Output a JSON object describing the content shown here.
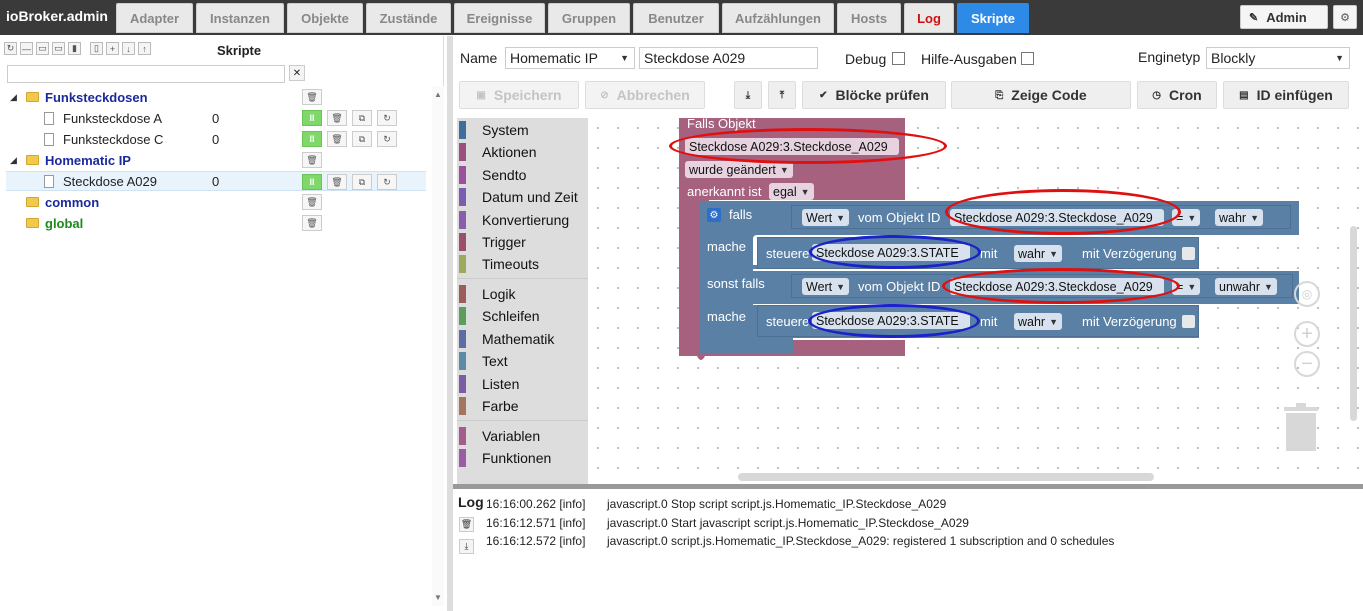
{
  "app": {
    "title": "ioBroker.admin"
  },
  "tabs": [
    {
      "label": "Adapter"
    },
    {
      "label": "Instanzen"
    },
    {
      "label": "Objekte"
    },
    {
      "label": "Zustände"
    },
    {
      "label": "Ereignisse"
    },
    {
      "label": "Gruppen"
    },
    {
      "label": "Benutzer"
    },
    {
      "label": "Aufzählungen"
    },
    {
      "label": "Hosts"
    },
    {
      "label": "Log"
    },
    {
      "label": "Skripte"
    }
  ],
  "user": {
    "name": "Admin"
  },
  "scripts_panel": {
    "title": "Skripte",
    "filter_value": "",
    "tree": [
      {
        "name": "Funksteckdosen",
        "type": "folder",
        "value": ""
      },
      {
        "name": "Funksteckdose A",
        "type": "script",
        "value": "0"
      },
      {
        "name": "Funksteckdose C",
        "type": "script",
        "value": "0"
      },
      {
        "name": "Homematic IP",
        "type": "folder",
        "value": ""
      },
      {
        "name": "Steckdose A029",
        "type": "script",
        "value": "0"
      },
      {
        "name": "common",
        "type": "folder",
        "value": ""
      },
      {
        "name": "global",
        "type": "folder",
        "value": ""
      }
    ]
  },
  "editor": {
    "name_label": "Name",
    "folder_select": "Homematic IP",
    "script_name": "Steckdose A029",
    "debug_label": "Debug",
    "hint_label": "Hilfe-Ausgaben",
    "engine_label": "Enginetyp",
    "engine_value": "Blockly",
    "buttons": {
      "save": "Speichern",
      "cancel": "Abbrechen",
      "check": "Blöcke prüfen",
      "show_code": "Zeige Code",
      "cron": "Cron",
      "insert_id": "ID einfügen"
    }
  },
  "toolbox": {
    "categories": [
      {
        "label": "System",
        "color": "#3e6f9c"
      },
      {
        "label": "Aktionen",
        "color": "#9c4f7c"
      },
      {
        "label": "Sendto",
        "color": "#9c4f9c"
      },
      {
        "label": "Datum und Zeit",
        "color": "#7c5cb0"
      },
      {
        "label": "Konvertierung",
        "color": "#8a5cb0"
      },
      {
        "label": "Trigger",
        "color": "#9c4f6c"
      },
      {
        "label": "Timeouts",
        "color": "#9caa5c"
      },
      {
        "label": "Logik",
        "color": "#9c5c5c"
      },
      {
        "label": "Schleifen",
        "color": "#5c9c5c"
      },
      {
        "label": "Mathematik",
        "color": "#5c6ca5"
      },
      {
        "label": "Text",
        "color": "#5c8ca5"
      },
      {
        "label": "Listen",
        "color": "#7c5ca5"
      },
      {
        "label": "Farbe",
        "color": "#a5745c"
      },
      {
        "label": "Variablen",
        "color": "#a55c8c"
      },
      {
        "label": "Funktionen",
        "color": "#9c5ca5"
      }
    ]
  },
  "blocks": {
    "trigger_title": "Falls Objekt",
    "trigger_object": "Steckdose A029:3.Steckdose_A029",
    "trigger_condition": "wurde geändert",
    "acknowledged_label": "anerkannt ist",
    "acknowledged_value": "egal",
    "if_label": "falls",
    "do_label": "mache",
    "elseif_label": "sonst falls",
    "value_label": "Wert",
    "from_object_label": "vom Objekt ID",
    "cond1_object": "Steckdose A029:3.Steckdose_A029",
    "cond1_op": "=",
    "cond1_value": "wahr",
    "action_label": "steuere",
    "action1_object": "Steckdose A029:3.STATE",
    "with_label": "mit",
    "action1_value": "wahr",
    "delay_label": "mit Verzögerung",
    "cond2_object": "Steckdose A029:3.Steckdose_A029",
    "cond2_op": "=",
    "cond2_value": "unwahr",
    "action2_object": "Steckdose A029:3.STATE",
    "action2_value": "wahr"
  },
  "log": {
    "title": "Log",
    "entries": [
      {
        "time": "16:16:00.262 [info]",
        "msg": "javascript.0 Stop script script.js.Homematic_IP.Steckdose_A029"
      },
      {
        "time": "16:16:12.571 [info]",
        "msg": "javascript.0 Start javascript script.js.Homematic_IP.Steckdose_A029"
      },
      {
        "time": "16:16:12.572 [info]",
        "msg": "javascript.0 script.js.Homematic_IP.Steckdose_A029: registered 1 subscription and 0 schedules"
      }
    ]
  },
  "colors": {
    "accent": "#2d8ae6",
    "event_block": "#a5617e",
    "logic_block": "#5b80a5",
    "highlight_red": "#e01010",
    "highlight_blue": "#1a22c8"
  }
}
